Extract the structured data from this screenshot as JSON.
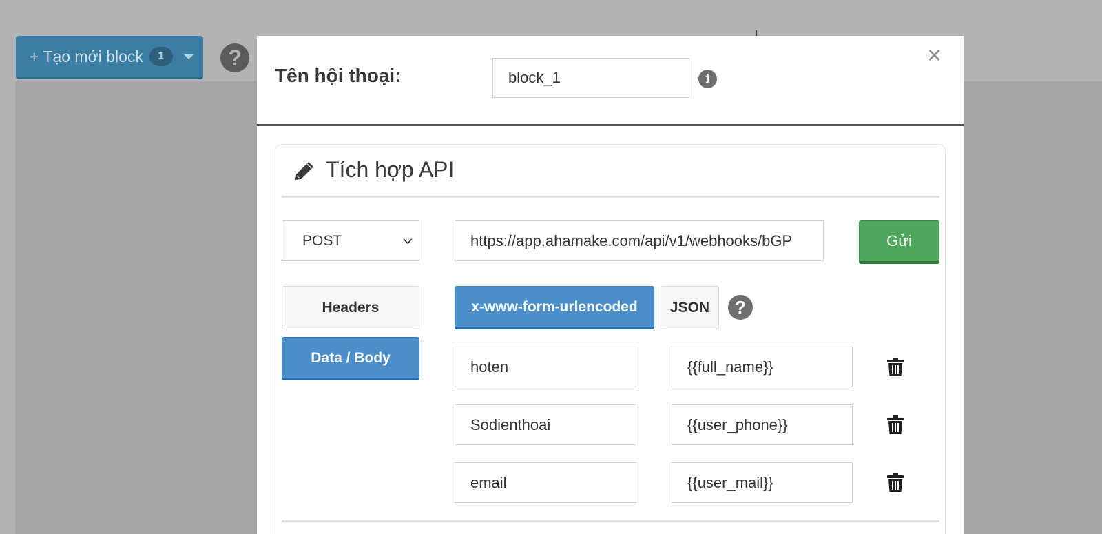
{
  "background": {
    "create_button": {
      "label": "+ Tạo mới block",
      "badge": "1"
    },
    "help_glyph": "?"
  },
  "modal": {
    "title": "Tên hội thoại:",
    "name_value": "block_1",
    "info_glyph": "i",
    "close_glyph": "×",
    "card": {
      "title": "Tích hợp API",
      "method": {
        "selected": "POST"
      },
      "url_value": "https://app.ahamake.com/api/v1/webhooks/bGP",
      "send_label": "Gửi",
      "tabs": {
        "headers": "Headers",
        "body": "Data / Body"
      },
      "encoding": {
        "form": "x-www-form-urlencoded",
        "json": "JSON"
      },
      "help_glyph": "?",
      "rows": [
        {
          "key": "hoten",
          "value": "{{full_name}}"
        },
        {
          "key": "Sodienthoai",
          "value": "{{user_phone}}"
        },
        {
          "key": "email",
          "value": "{{user_mail}}"
        }
      ]
    }
  },
  "colors": {
    "primary": "#4a8fca",
    "success": "#4da75a",
    "overlay": "#b3b3b3"
  }
}
